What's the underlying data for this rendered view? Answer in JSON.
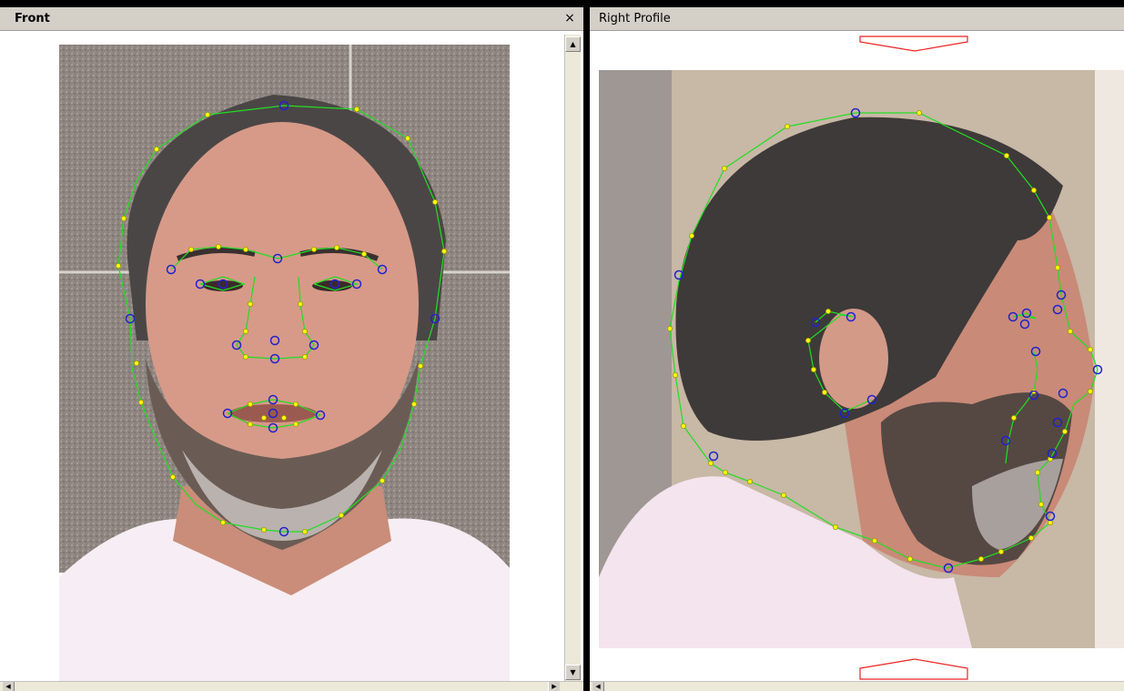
{
  "panes": {
    "front": {
      "title": "Front",
      "close_glyph": "×"
    },
    "profile": {
      "title": "Right Profile"
    }
  },
  "icons": {
    "scroll_up": "▲",
    "scroll_down": "▼",
    "scroll_left": "◀",
    "scroll_right": "▶"
  },
  "colors": {
    "contour": "#22dd22",
    "point_fill": "#ffff00",
    "point_stroke": "#999900",
    "landmark": "#2222cc",
    "marker_outline": "#ee2222",
    "titlebar": "#d4d0c8"
  }
}
